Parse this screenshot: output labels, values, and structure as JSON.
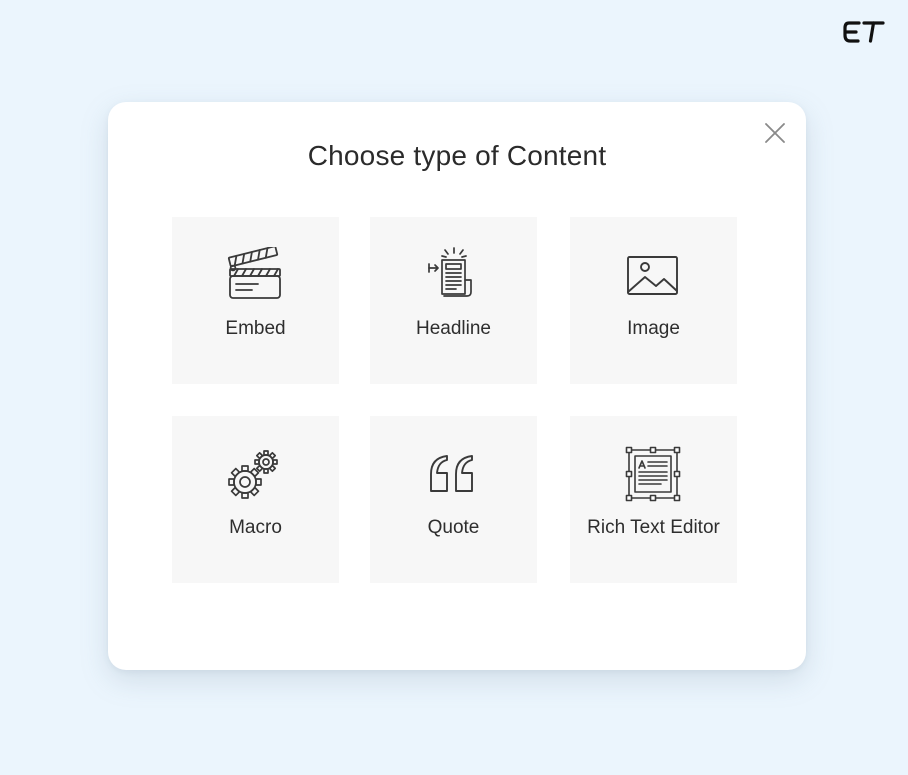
{
  "brand": {
    "logo_text": "ET"
  },
  "modal": {
    "title": "Choose type of Content",
    "close_icon": "close-icon",
    "options": [
      {
        "label": "Embed",
        "icon": "clapperboard-icon"
      },
      {
        "label": "Headline",
        "icon": "newspaper-icon"
      },
      {
        "label": "Image",
        "icon": "image-icon"
      },
      {
        "label": "Macro",
        "icon": "gears-icon"
      },
      {
        "label": "Quote",
        "icon": "quote-icon"
      },
      {
        "label": "Rich Text Editor",
        "icon": "text-editor-icon"
      }
    ]
  },
  "colors": {
    "page_background": "#ebf5fd",
    "modal_background": "#ffffff",
    "tile_background": "#f7f7f7",
    "text": "#2e2e2e",
    "icon_stroke": "#3a3a3a"
  }
}
